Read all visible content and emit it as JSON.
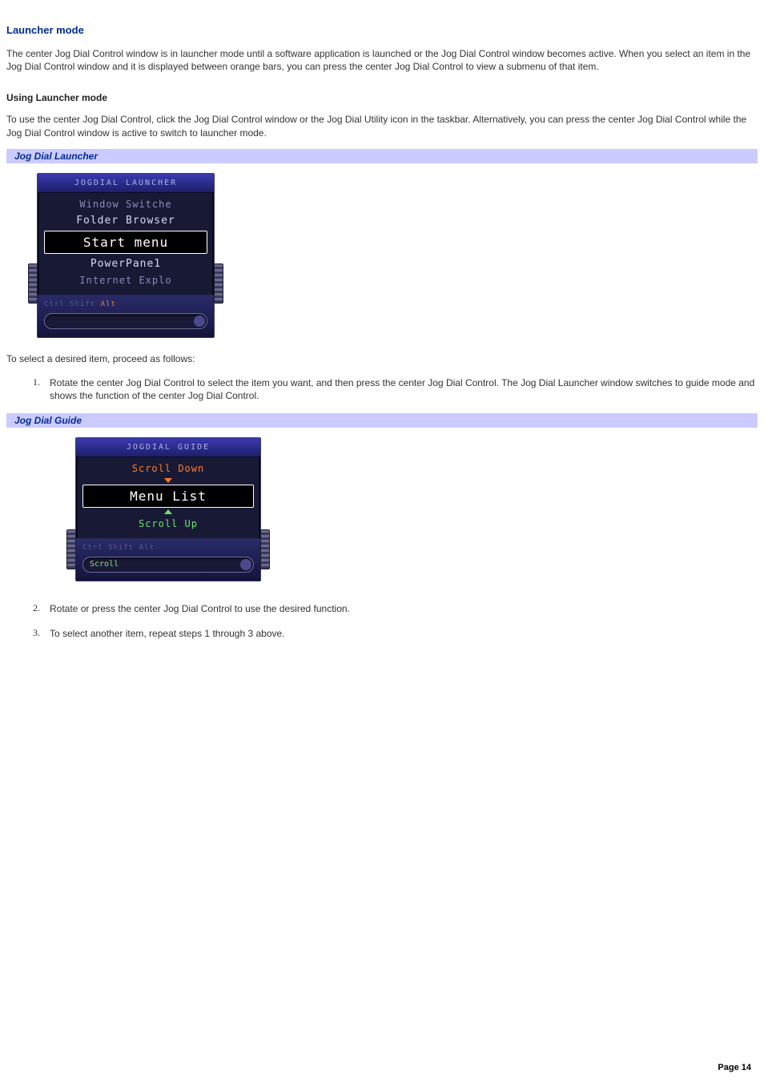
{
  "heading": "Launcher mode",
  "intro": "The center Jog Dial Control window is in launcher mode until a software application is launched or the Jog Dial Control window becomes active. When you select an item in the Jog Dial Control window and it is displayed between orange bars, you can press the center Jog Dial Control to view a submenu of that item.",
  "subheading": "Using Launcher mode",
  "para2": "To use the center Jog Dial Control, click the Jog Dial Control window or the Jog Dial Utility icon in the taskbar. Alternatively, you can press the center Jog Dial Control while the Jog Dial Control window is active to switch to launcher mode.",
  "caption1": "Jog Dial Launcher",
  "launcher": {
    "title": "JOGDIAL LAUNCHER",
    "items": [
      "Window Switche",
      "Folder Browser",
      "Start menu",
      "PowerPane1",
      "Internet Explo"
    ],
    "keys_dim": "Ctrl  Shift",
    "keys_active": "Alt"
  },
  "select_lead": "To select a desired item, proceed as follows:",
  "steps": {
    "s1_num": "1.",
    "s1": "Rotate the center Jog Dial Control to select the item you want, and then press the center Jog Dial Control. The Jog Dial Launcher window switches to guide mode and shows the function of the center Jog Dial Control.",
    "s2_num": "2.",
    "s2": "Rotate or press the center Jog Dial Control to use the desired function.",
    "s3_num": "3.",
    "s3": "To select another item, repeat steps 1 through 3 above."
  },
  "caption2": "Jog Dial Guide",
  "guide": {
    "title": "JOGDIAL GUIDE",
    "scroll_down": "Scroll Down",
    "menu_list": "Menu List",
    "scroll_up": "Scroll Up",
    "keys_dim": "Ctrl  Shift   Alt",
    "slot_label": "Scroll"
  },
  "page_number": "Page 14"
}
